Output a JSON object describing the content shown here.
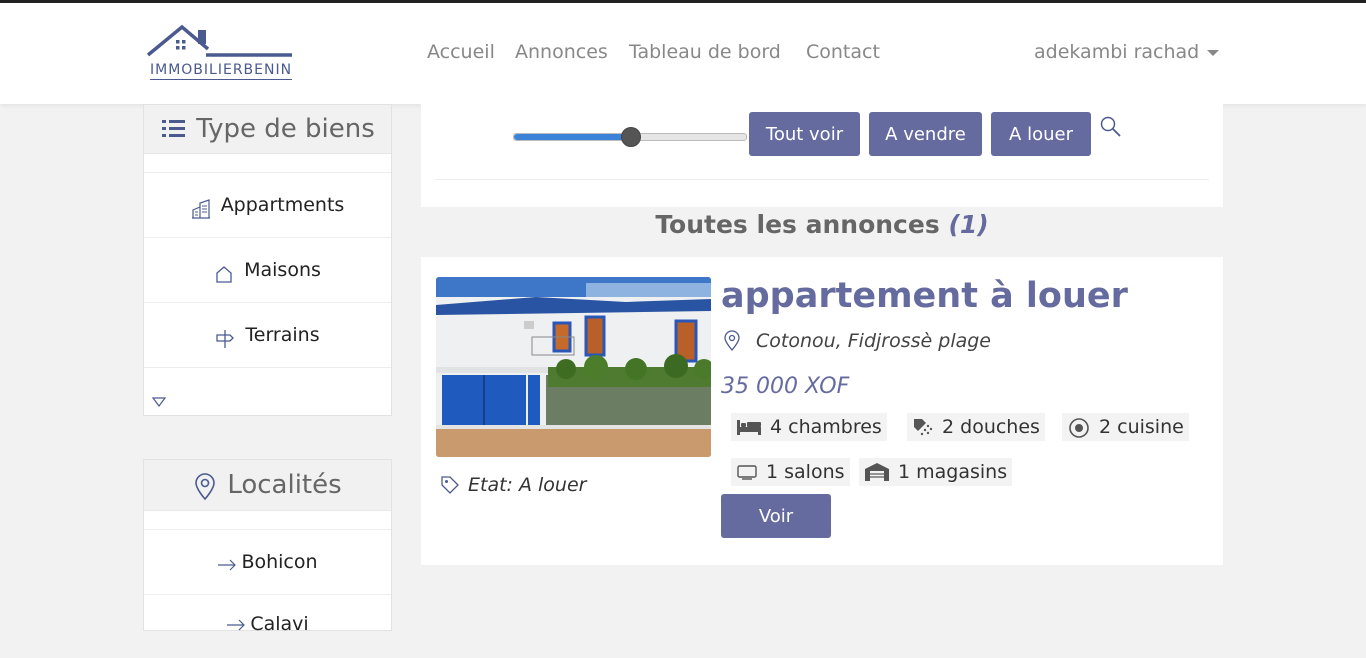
{
  "brand": {
    "name": "IMMOBILIERBENIN"
  },
  "nav": {
    "links": [
      "Accueil",
      "Annonces",
      "Tableau de bord",
      "Contact"
    ],
    "user": "adekambi rachad"
  },
  "sidebar": {
    "types": {
      "title": "Type de biens",
      "items": [
        "Appartments",
        "Maisons",
        "Terrains"
      ]
    },
    "localites": {
      "title": "Localités",
      "items": [
        "Bohicon",
        "Calavi"
      ]
    }
  },
  "filters": {
    "range_fraction": 0.5,
    "buttons": [
      "Tout voir",
      "A vendre",
      "A louer"
    ]
  },
  "listings": {
    "heading": "Toutes les annonces",
    "count": "(1)",
    "item": {
      "title": "appartement à louer",
      "location": "Cotonou, Fidjrossè plage",
      "price": "35 000 XOF",
      "features": [
        "4 chambres",
        "2 douches",
        "2 cuisine",
        "1 salons",
        "1 magasins"
      ],
      "etat": "Etat: A louer",
      "voir": "Voir"
    }
  },
  "colors": {
    "accent": "#656b9f",
    "slider": "#3b82d9"
  }
}
